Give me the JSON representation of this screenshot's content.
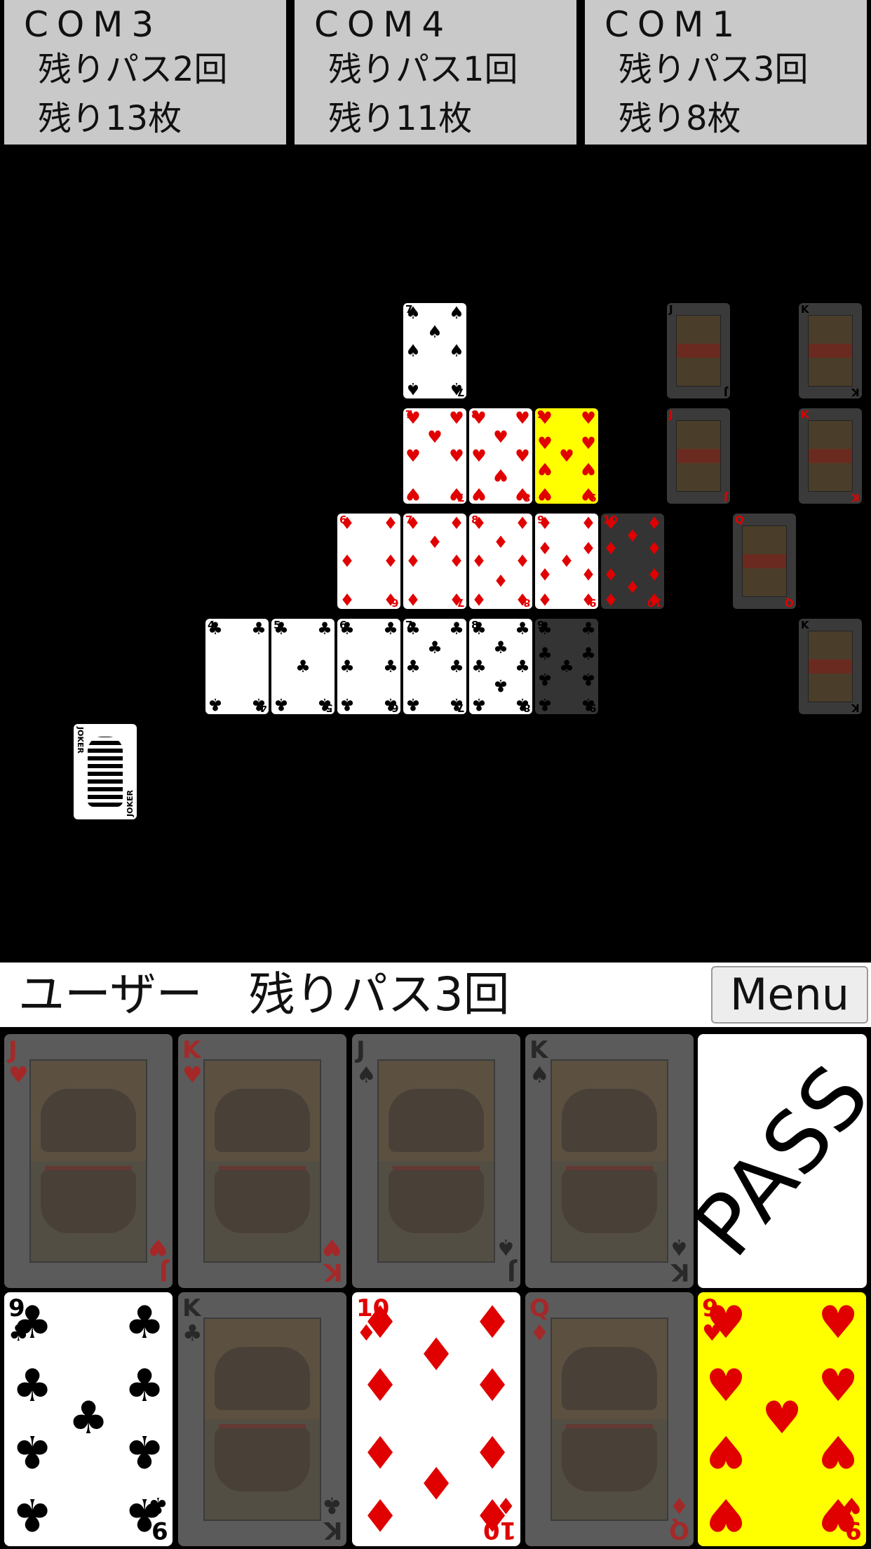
{
  "opponents": [
    {
      "name": "COM3",
      "pass_text": "残りパス2回",
      "cards_text": "残り13枚"
    },
    {
      "name": "COM4",
      "pass_text": "残りパス1回",
      "cards_text": "残り11枚"
    },
    {
      "name": "COM1",
      "pass_text": "残りパス3回",
      "cards_text": "残り8枚"
    }
  ],
  "user": {
    "label": "ユーザー　残りパス3回",
    "menu_label": "Menu"
  },
  "table_cards": [
    {
      "rank": "7",
      "suit": "spade",
      "row": 0,
      "col": 6,
      "state": "normal"
    },
    {
      "rank": "J",
      "suit": "spade",
      "row": 0,
      "col": 10,
      "state": "dim"
    },
    {
      "rank": "K",
      "suit": "spade",
      "row": 0,
      "col": 12,
      "state": "dim"
    },
    {
      "rank": "7",
      "suit": "heart",
      "row": 1,
      "col": 6,
      "state": "normal"
    },
    {
      "rank": "8",
      "suit": "heart",
      "row": 1,
      "col": 7,
      "state": "normal"
    },
    {
      "rank": "9",
      "suit": "heart",
      "row": 1,
      "col": 8,
      "state": "highlight"
    },
    {
      "rank": "J",
      "suit": "heart",
      "row": 1,
      "col": 10,
      "state": "dim"
    },
    {
      "rank": "K",
      "suit": "heart",
      "row": 1,
      "col": 12,
      "state": "dim"
    },
    {
      "rank": "6",
      "suit": "diamond",
      "row": 2,
      "col": 5,
      "state": "normal"
    },
    {
      "rank": "7",
      "suit": "diamond",
      "row": 2,
      "col": 6,
      "state": "normal"
    },
    {
      "rank": "8",
      "suit": "diamond",
      "row": 2,
      "col": 7,
      "state": "normal"
    },
    {
      "rank": "9",
      "suit": "diamond",
      "row": 2,
      "col": 8,
      "state": "normal"
    },
    {
      "rank": "10",
      "suit": "diamond",
      "row": 2,
      "col": 9,
      "state": "dim"
    },
    {
      "rank": "Q",
      "suit": "diamond",
      "row": 2,
      "col": 11,
      "state": "dim"
    },
    {
      "rank": "4",
      "suit": "club",
      "row": 3,
      "col": 3,
      "state": "normal"
    },
    {
      "rank": "5",
      "suit": "club",
      "row": 3,
      "col": 4,
      "state": "normal"
    },
    {
      "rank": "6",
      "suit": "club",
      "row": 3,
      "col": 5,
      "state": "normal"
    },
    {
      "rank": "7",
      "suit": "club",
      "row": 3,
      "col": 6,
      "state": "normal"
    },
    {
      "rank": "8",
      "suit": "club",
      "row": 3,
      "col": 7,
      "state": "normal"
    },
    {
      "rank": "9",
      "suit": "club",
      "row": 3,
      "col": 8,
      "state": "dim"
    },
    {
      "rank": "K",
      "suit": "club",
      "row": 3,
      "col": 12,
      "state": "dim"
    },
    {
      "rank": "JOKER",
      "suit": "joker",
      "row": 4,
      "col": 1,
      "state": "normal"
    }
  ],
  "hand": [
    {
      "rank": "J",
      "suit": "heart",
      "state": "dim"
    },
    {
      "rank": "K",
      "suit": "heart",
      "state": "dim"
    },
    {
      "rank": "J",
      "suit": "spade",
      "state": "dim"
    },
    {
      "rank": "K",
      "suit": "spade",
      "state": "dim"
    },
    {
      "rank": "9",
      "suit": "club",
      "state": "normal"
    },
    {
      "rank": "K",
      "suit": "club",
      "state": "dim"
    },
    {
      "rank": "10",
      "suit": "diamond",
      "state": "normal"
    },
    {
      "rank": "Q",
      "suit": "diamond",
      "state": "dim"
    },
    {
      "rank": "9",
      "suit": "heart",
      "state": "highlight"
    }
  ],
  "pass_button": {
    "label": "PASS"
  },
  "colors": {
    "table_bg": "#000000",
    "panel_bg": "#c9c9c9",
    "highlight": "#ffff00",
    "red_suit": "#e00000",
    "black_suit": "#000000"
  }
}
